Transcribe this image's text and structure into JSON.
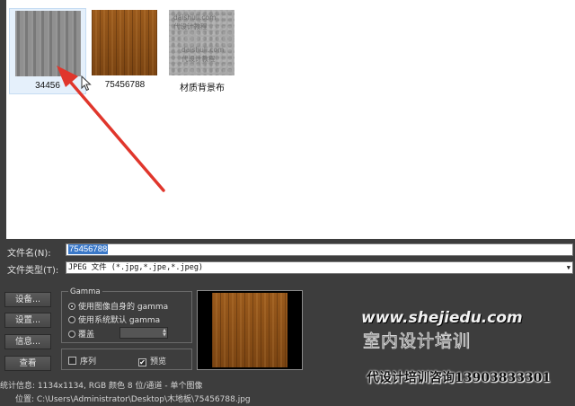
{
  "files": [
    {
      "name": "34456",
      "thumb": "gray-wood-texture",
      "selected": true
    },
    {
      "name": "75456788",
      "thumb": "brown-wood-texture",
      "selected": false
    },
    {
      "name": "材质背景布",
      "thumb": "gray-fabric-texture",
      "selected": false,
      "watermark": [
        "daishuli.com",
        "代设计教程",
        "daishuli.com",
        "代设计教程"
      ]
    }
  ],
  "filename_label": "文件名(N):",
  "filename_value": "75456788",
  "filetype_label": "文件类型(T):",
  "filetype_value": "JPEG 文件 (*.jpg,*.jpe,*.jpeg)",
  "buttons": [
    "设备...",
    "设置...",
    "信息...",
    "查看"
  ],
  "gamma": {
    "title": "Gamma",
    "options": [
      "使用图像自身的 gamma",
      "使用系统默认 gamma",
      "覆盖"
    ],
    "selected_index": 0
  },
  "checkboxes": [
    {
      "label": "序列",
      "checked": false
    },
    {
      "label": "预览",
      "checked": true
    }
  ],
  "stats": "统计信息: 1134x1134, RGB 颜色 8 位/通道 - 单个图像",
  "location": "位置: C:\\Users\\Administrator\\Desktop\\木地板\\75456788.jpg",
  "watermark": {
    "url": "www.shejiedu.com",
    "brand": "室内设计培训",
    "contact": "代设计培训咨询13903833301"
  },
  "colors": {
    "arrow": "#e0362c",
    "selection": "#3a78c8"
  }
}
